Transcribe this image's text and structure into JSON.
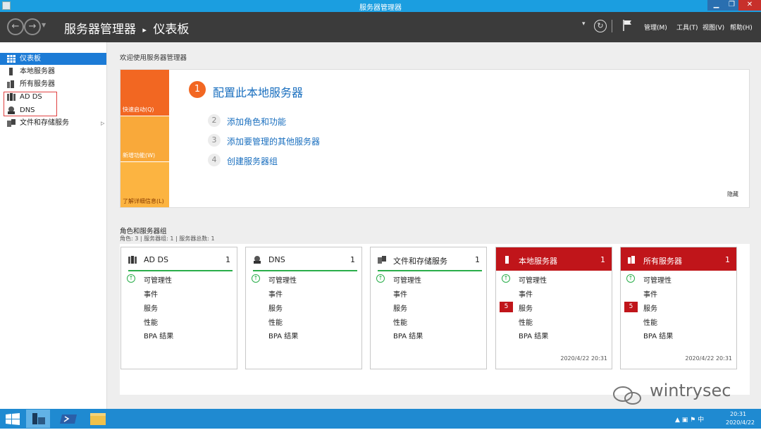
{
  "window": {
    "title": "服务器管理器",
    "min": "▁",
    "max": "❐",
    "close": "✕"
  },
  "header": {
    "breadcrumb_app": "服务器管理器",
    "breadcrumb_sep": "▸",
    "breadcrumb_page": "仪表板",
    "refresh": "↻",
    "menus": [
      "管理(M)",
      "工具(T)",
      "视图(V)",
      "帮助(H)"
    ]
  },
  "sidebar": {
    "items": [
      {
        "label": "仪表板",
        "icon": "dashboard-icon",
        "selected": true
      },
      {
        "label": "本地服务器",
        "icon": "server-icon"
      },
      {
        "label": "所有服务器",
        "icon": "servers-icon"
      },
      {
        "label": "AD DS",
        "icon": "ad-ds-icon"
      },
      {
        "label": "DNS",
        "icon": "dns-icon"
      },
      {
        "label": "文件和存储服务",
        "icon": "file-storage-icon",
        "expandable": true
      }
    ]
  },
  "welcome": {
    "heading": "欢迎使用服务器管理器",
    "tiles": [
      "快速启动(Q)",
      "新增功能(W)",
      "了解详细信息(L)"
    ],
    "steps": [
      {
        "num": "1",
        "label": "配置此本地服务器"
      },
      {
        "num": "2",
        "label": "添加角色和功能"
      },
      {
        "num": "3",
        "label": "添加要管理的其他服务器"
      },
      {
        "num": "4",
        "label": "创建服务器组"
      }
    ],
    "hide": "隐藏"
  },
  "roles": {
    "heading": "角色和服务器组",
    "summary": "角色: 3 | 服务器组: 1 | 服务器总数: 1",
    "cards": [
      {
        "name": "AD DS",
        "count": "1",
        "rows": [
          "可管理性",
          "事件",
          "服务",
          "性能",
          "BPA 结果"
        ],
        "badge": "",
        "timestamp": "",
        "style": "normal"
      },
      {
        "name": "DNS",
        "count": "1",
        "rows": [
          "可管理性",
          "事件",
          "服务",
          "性能",
          "BPA 结果"
        ],
        "badge": "",
        "timestamp": "",
        "style": "normal"
      },
      {
        "name": "文件和存储服务",
        "count": "1",
        "rows": [
          "可管理性",
          "事件",
          "服务",
          "性能",
          "BPA 结果"
        ],
        "badge": "",
        "timestamp": "",
        "style": "normal"
      },
      {
        "name": "本地服务器",
        "count": "1",
        "rows": [
          "可管理性",
          "事件",
          "服务",
          "性能",
          "BPA 结果"
        ],
        "badge": "5",
        "timestamp": "2020/4/22 20:31",
        "style": "alert"
      },
      {
        "name": "所有服务器",
        "count": "1",
        "rows": [
          "可管理性",
          "事件",
          "服务",
          "性能",
          "BPA 结果"
        ],
        "badge": "5",
        "timestamp": "2020/4/22 20:31",
        "style": "alert"
      }
    ]
  },
  "watermark": "wintrysec",
  "taskbar": {
    "tray": "▲ ▣ ⚑ 中",
    "time": "20:31",
    "date": "2020/4/22"
  },
  "colors": {
    "accent": "#1c7bd6",
    "orange": "#f26722",
    "alert": "#c0151a",
    "ok": "#2aae4a"
  }
}
